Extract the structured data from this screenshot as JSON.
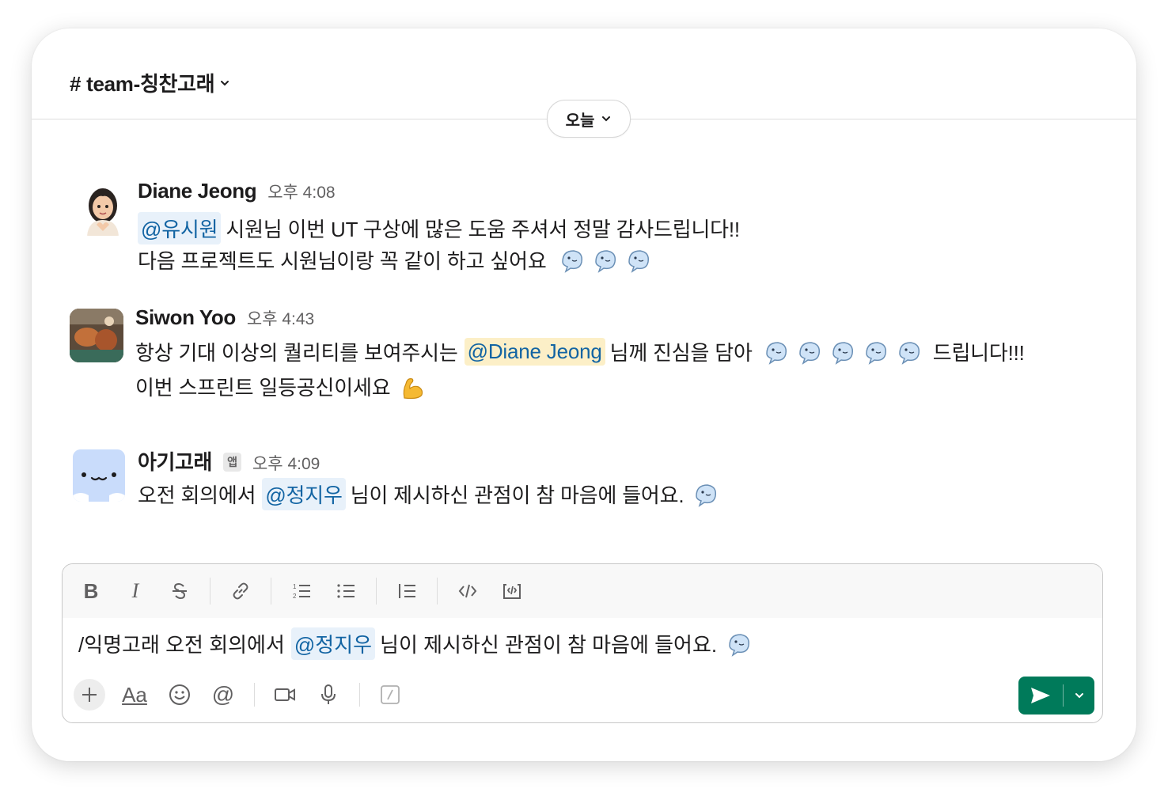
{
  "channel": {
    "name": "# team-칭찬고래",
    "chevron_icon": "chevron-down-icon"
  },
  "date_divider": {
    "label": "오늘"
  },
  "messages": [
    {
      "author": "Diane Jeong",
      "time": "오후 4:08",
      "avatar": "memoji-heart-hands",
      "lines": [
        {
          "mention": "@유시원",
          "text": "시원님 이번 UT 구상에 많은 도움 주셔서 정말 감사드립니다!!"
        },
        {
          "text": "다음 프로젝트도 시원님이랑 꼭 같이 하고 싶어요",
          "emoji": [
            "whale",
            "whale",
            "whale"
          ]
        }
      ]
    },
    {
      "author": "Siwon Yoo",
      "time": "오후 4:43",
      "avatar": "photo-food",
      "lines": [
        {
          "before": "항상 기대 이상의 퀄리티를 보여주시는",
          "mention": "@Diane Jeong",
          "text": "님께 진심을 담아",
          "emoji": [
            "whale",
            "whale",
            "whale",
            "whale",
            "whale"
          ],
          "after": "드립니다!!!"
        },
        {
          "text": "이번 스프린트 일등공신이세요",
          "emoji": [
            "flexed-biceps"
          ]
        }
      ]
    },
    {
      "author": "아기고래",
      "badge": "앱",
      "time": "오후 4:09",
      "avatar": "baby-whale-app",
      "lines": [
        {
          "before": "오전 회의에서",
          "mention": "@정지우",
          "text": "님이 제시하신 관점이 참 마음에 들어요.",
          "emoji": [
            "whale"
          ]
        }
      ]
    }
  ],
  "composer": {
    "toolbar": [
      "bold-icon",
      "italic-icon",
      "strikethrough-icon",
      "link-icon",
      "ordered-list-icon",
      "bulleted-list-icon",
      "blockquote-icon",
      "code-icon",
      "code-block-icon"
    ],
    "input": {
      "before": "/익명고래 오전 회의에서",
      "mention": "@정지우",
      "text": "님이 제시하신 관점이 참 마음에 들어요.",
      "emoji": [
        "whale"
      ]
    },
    "actions": [
      "plus-icon",
      "format-text-icon",
      "emoji-icon",
      "mention-icon",
      "video-icon",
      "microphone-icon",
      "slash-command-icon"
    ],
    "format_label": "Aa",
    "send": {
      "icon": "send-icon",
      "dropdown_icon": "chevron-down-icon"
    }
  },
  "colors": {
    "mention_bg": "#e8f1fa",
    "mention_self_bg": "#fcefc7",
    "mention_text": "#1264a3",
    "send_green": "#007a5a"
  }
}
